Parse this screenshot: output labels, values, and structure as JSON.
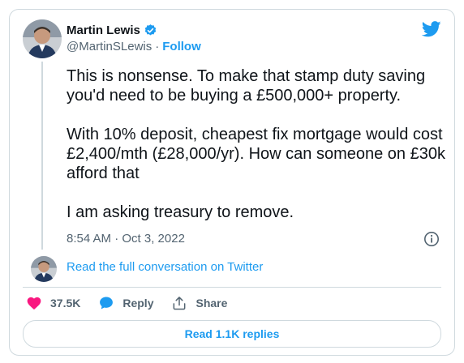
{
  "author": {
    "display_name": "Martin Lewis",
    "handle": "@MartinSLewis",
    "separator": "·",
    "follow_label": "Follow",
    "verified": true
  },
  "tweet": {
    "paragraphs": [
      "This is nonsense. To make that stamp duty saving you'd need to be buying a £500,000+ property.",
      "With 10% deposit, cheapest fix mortgage would cost £2,400/mth (£28,000/yr). How can someone on £30k afford that",
      "I am asking treasury to remove."
    ],
    "timestamp": "8:54 AM · Oct 3, 2022"
  },
  "conversation": {
    "link_label": "Read the full conversation on Twitter"
  },
  "actions": {
    "like_count": "37.5K",
    "reply_label": "Reply",
    "share_label": "Share"
  },
  "replies_button": "Read 1.1K replies",
  "colors": {
    "accent": "#1d9bf0",
    "like": "#f91880",
    "text": "#0f1419",
    "muted": "#536471",
    "border": "#cfd9de"
  },
  "icons": [
    "verified-badge-icon",
    "twitter-bird-icon",
    "info-icon",
    "heart-icon",
    "reply-bubble-icon",
    "share-icon"
  ]
}
